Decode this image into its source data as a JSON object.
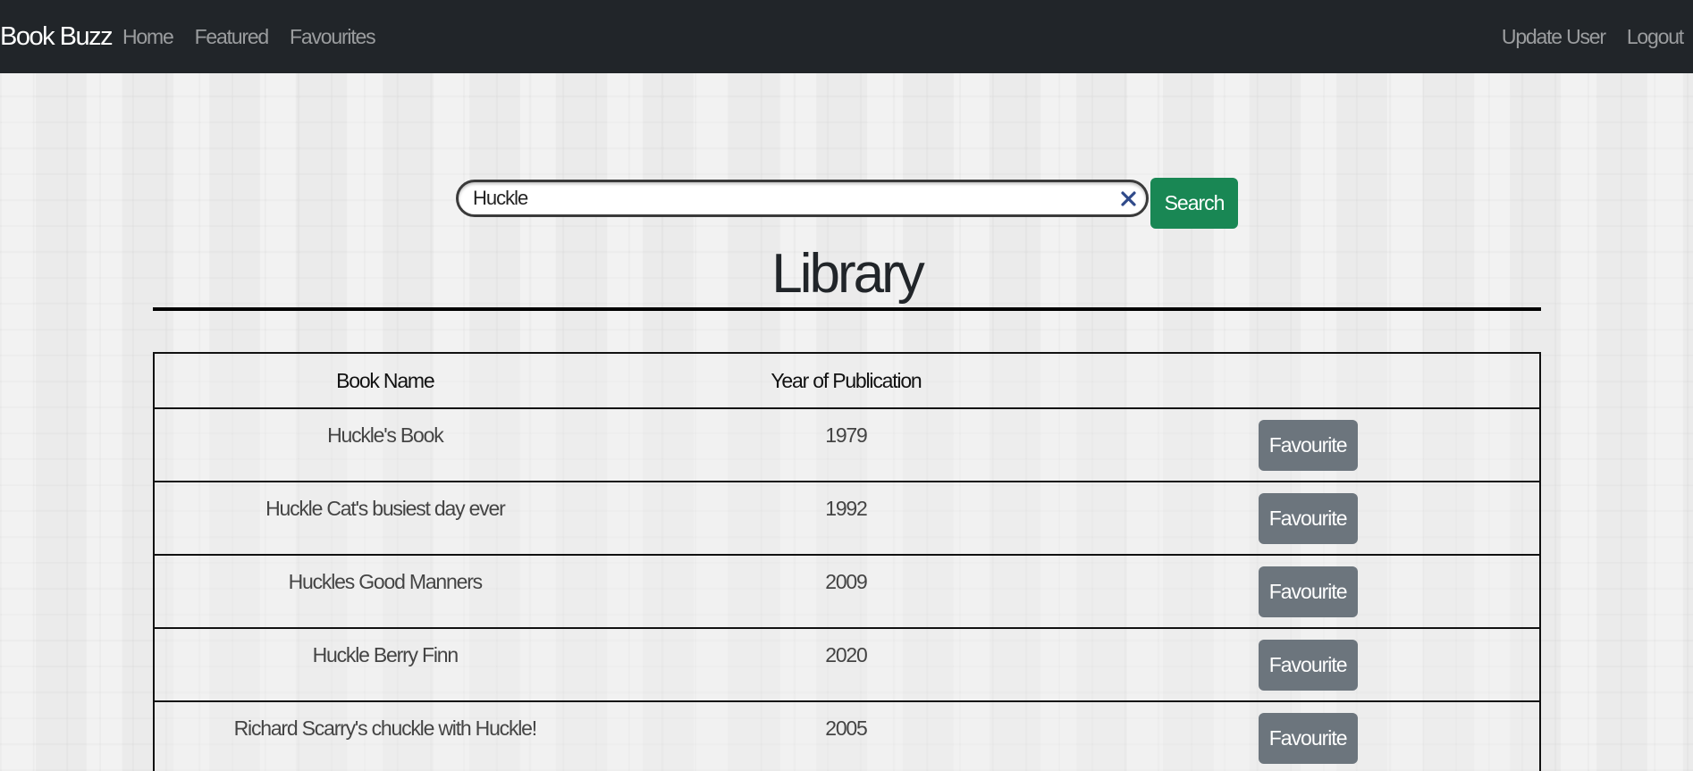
{
  "navbar": {
    "brand": "Book Buzz",
    "links": [
      "Home",
      "Featured",
      "Favourites"
    ],
    "right_links": [
      "Update User",
      "Logout"
    ]
  },
  "search": {
    "value": "Huckle",
    "button_label": "Search",
    "clear_icon": "close-icon"
  },
  "page": {
    "title": "Library"
  },
  "table": {
    "headers": [
      "Book Name",
      "Year of Publication",
      ""
    ],
    "rows": [
      {
        "name": "Huckle's Book",
        "year": "1979",
        "action": "Favourite"
      },
      {
        "name": "Huckle Cat's busiest day ever",
        "year": "1992",
        "action": "Favourite"
      },
      {
        "name": "Huckles Good Manners",
        "year": "2009",
        "action": "Favourite"
      },
      {
        "name": "Huckle Berry Finn",
        "year": "2020",
        "action": "Favourite"
      },
      {
        "name": "Richard Scarry's chuckle with Huckle!",
        "year": "2005",
        "action": "Favourite"
      }
    ]
  },
  "colors": {
    "navbar_bg": "#212529",
    "search_button": "#198754",
    "favourite_button": "#6c757d",
    "clear_icon": "#2f4a8a"
  }
}
